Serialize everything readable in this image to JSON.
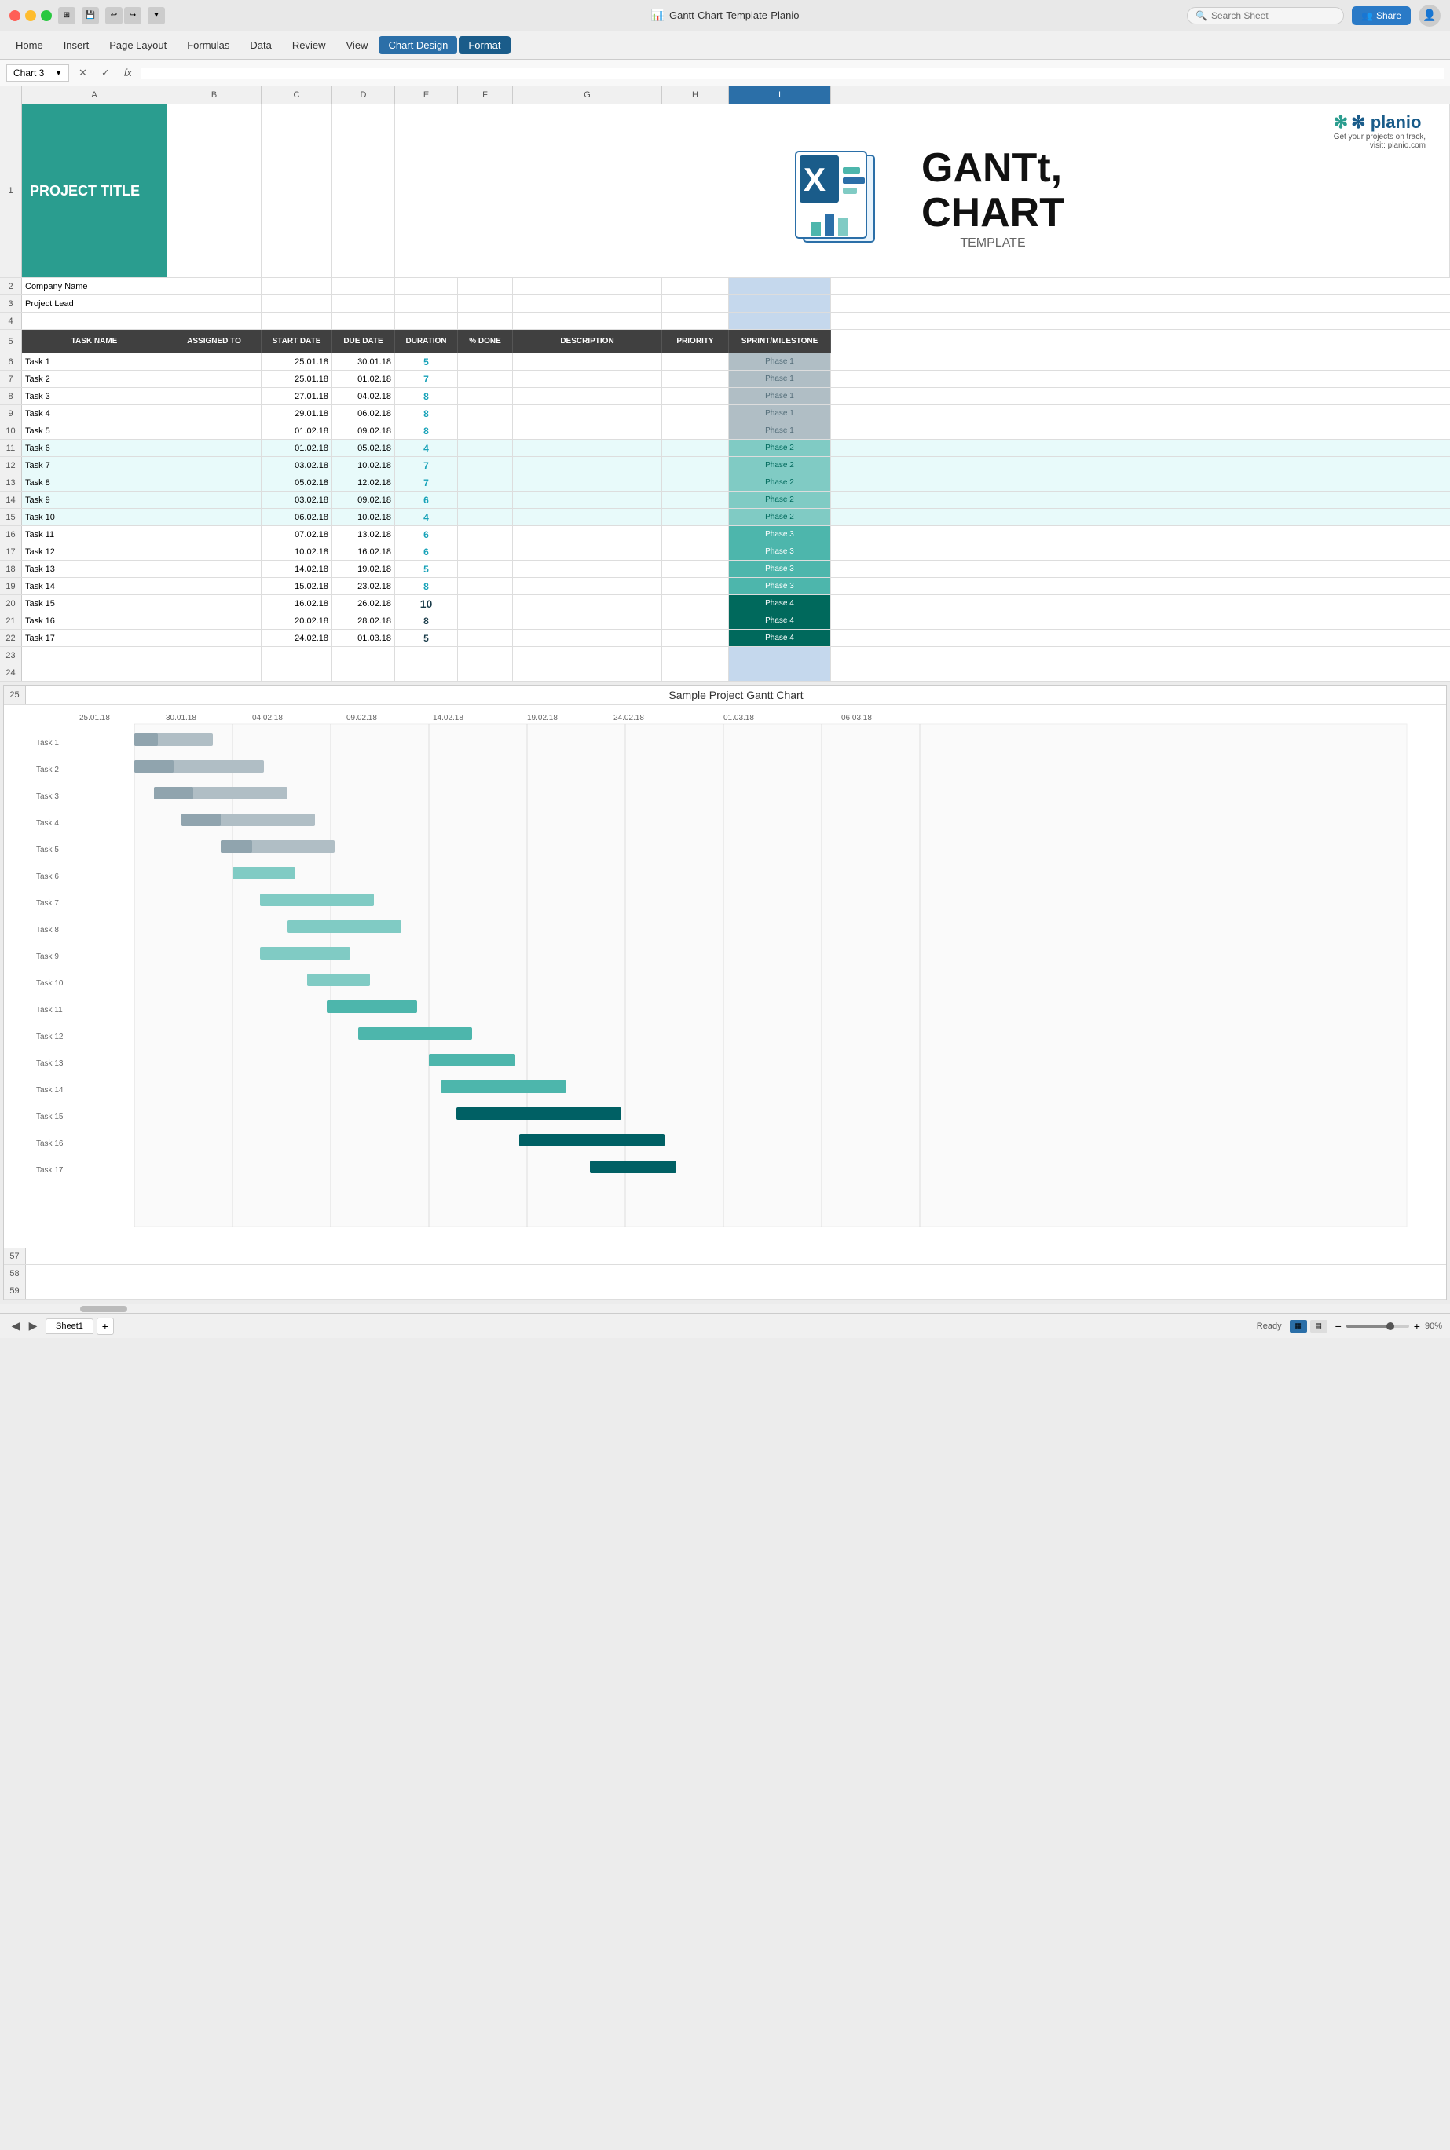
{
  "titlebar": {
    "traffic": [
      "red",
      "yellow",
      "green"
    ],
    "icons": [
      "grid",
      "save",
      "undo",
      "redo",
      "more"
    ],
    "filename": "Gantt-Chart-Template-Planio",
    "search_placeholder": "Search Sheet",
    "share_label": "Share",
    "avatar": "user"
  },
  "menubar": {
    "items": [
      {
        "label": "Home",
        "active": false
      },
      {
        "label": "Insert",
        "active": false
      },
      {
        "label": "Page Layout",
        "active": false
      },
      {
        "label": "Formulas",
        "active": false
      },
      {
        "label": "Data",
        "active": false
      },
      {
        "label": "Review",
        "active": false
      },
      {
        "label": "View",
        "active": false
      },
      {
        "label": "Chart Design",
        "active": true
      },
      {
        "label": "Format",
        "active": true
      }
    ]
  },
  "formulabar": {
    "cell_ref": "Chart 3",
    "x_label": "✕",
    "check_label": "✓",
    "fx_label": "fx",
    "formula": ""
  },
  "columns": {
    "headers": [
      "A",
      "B",
      "C",
      "D",
      "E",
      "F",
      "G",
      "H",
      "I"
    ],
    "widths": [
      185,
      120,
      90,
      80,
      80,
      70,
      190,
      85,
      130
    ]
  },
  "rows": {
    "row1": {
      "num": "1",
      "A": "PROJECT TITLE"
    },
    "row2": {
      "num": "2",
      "A": "Company Name"
    },
    "row3": {
      "num": "3",
      "A": "Project Lead"
    },
    "row4": {
      "num": "4"
    },
    "row5_header": {
      "num": "5",
      "A": "TASK NAME",
      "B": "ASSIGNED TO",
      "C": "START DATE",
      "D": "DUE DATE",
      "E": "DURATION",
      "F": "% DONE",
      "G": "DESCRIPTION",
      "H": "PRIORITY",
      "I": "SPRINT/MILESTONE"
    },
    "tasks": [
      {
        "num": "6",
        "name": "Task 1",
        "start": "25.01.18",
        "due": "30.01.18",
        "dur": "5",
        "done": "",
        "desc": "",
        "priority": "",
        "sprint": "Phase 1",
        "phase": 1
      },
      {
        "num": "7",
        "name": "Task 2",
        "start": "25.01.18",
        "due": "01.02.18",
        "dur": "7",
        "done": "",
        "desc": "",
        "priority": "",
        "sprint": "Phase 1",
        "phase": 1
      },
      {
        "num": "8",
        "name": "Task 3",
        "start": "27.01.18",
        "due": "04.02.18",
        "dur": "8",
        "done": "",
        "desc": "",
        "priority": "",
        "sprint": "Phase 1",
        "phase": 1
      },
      {
        "num": "9",
        "name": "Task 4",
        "start": "29.01.18",
        "due": "06.02.18",
        "dur": "8",
        "done": "",
        "desc": "",
        "priority": "",
        "sprint": "Phase 1",
        "phase": 1
      },
      {
        "num": "10",
        "name": "Task 5",
        "start": "01.02.18",
        "due": "09.02.18",
        "dur": "8",
        "done": "",
        "desc": "",
        "priority": "",
        "sprint": "Phase 1",
        "phase": 1
      },
      {
        "num": "11",
        "name": "Task 6",
        "start": "01.02.18",
        "due": "05.02.18",
        "dur": "4",
        "done": "",
        "desc": "",
        "priority": "",
        "sprint": "Phase 2",
        "phase": 2
      },
      {
        "num": "12",
        "name": "Task 7",
        "start": "03.02.18",
        "due": "10.02.18",
        "dur": "7",
        "done": "",
        "desc": "",
        "priority": "",
        "sprint": "Phase 2",
        "phase": 2
      },
      {
        "num": "13",
        "name": "Task 8",
        "start": "05.02.18",
        "due": "12.02.18",
        "dur": "7",
        "done": "",
        "desc": "",
        "priority": "",
        "sprint": "Phase 2",
        "phase": 2
      },
      {
        "num": "14",
        "name": "Task 9",
        "start": "03.02.18",
        "due": "09.02.18",
        "dur": "6",
        "done": "",
        "desc": "",
        "priority": "",
        "sprint": "Phase 2",
        "phase": 2
      },
      {
        "num": "15",
        "name": "Task 10",
        "start": "06.02.18",
        "due": "10.02.18",
        "dur": "4",
        "done": "",
        "desc": "",
        "priority": "",
        "sprint": "Phase 2",
        "phase": 2
      },
      {
        "num": "16",
        "name": "Task 11",
        "start": "07.02.18",
        "due": "13.02.18",
        "dur": "6",
        "done": "",
        "desc": "",
        "priority": "",
        "sprint": "Phase 3",
        "phase": 3
      },
      {
        "num": "17",
        "name": "Task 12",
        "start": "10.02.18",
        "due": "16.02.18",
        "dur": "6",
        "done": "",
        "desc": "",
        "priority": "",
        "sprint": "Phase 3",
        "phase": 3
      },
      {
        "num": "18",
        "name": "Task 13",
        "start": "14.02.18",
        "due": "19.02.18",
        "dur": "5",
        "done": "",
        "desc": "",
        "priority": "",
        "sprint": "Phase 3",
        "phase": 3
      },
      {
        "num": "19",
        "name": "Task 14",
        "start": "15.02.18",
        "due": "23.02.18",
        "dur": "8",
        "done": "",
        "desc": "",
        "priority": "",
        "sprint": "Phase 3",
        "phase": 3
      },
      {
        "num": "20",
        "name": "Task 15",
        "start": "16.02.18",
        "due": "26.02.18",
        "dur": "10",
        "done": "",
        "desc": "",
        "priority": "",
        "sprint": "Phase 4",
        "phase": 4
      },
      {
        "num": "21",
        "name": "Task 16",
        "start": "20.02.18",
        "due": "28.02.18",
        "dur": "8",
        "done": "",
        "desc": "",
        "priority": "",
        "sprint": "Phase 4",
        "phase": 4
      },
      {
        "num": "22",
        "name": "Task 17",
        "start": "24.02.18",
        "due": "01.03.18",
        "dur": "5",
        "done": "",
        "desc": "",
        "priority": "",
        "sprint": "Phase 4",
        "phase": 4
      }
    ],
    "empty_rows": [
      "23",
      "24"
    ]
  },
  "gantt_chart": {
    "title": "Sample Project Gantt Chart",
    "dates": [
      "25.01.18",
      "30.01.18",
      "04.02.18",
      "09.02.18",
      "14.02.18",
      "19.02.18",
      "24.02.18",
      "01.03.18",
      "06.03.18"
    ],
    "bars": [
      {
        "task": "Task 1",
        "start": 0,
        "width": 9,
        "phase": 1
      },
      {
        "task": "Task 2",
        "start": 0,
        "width": 13,
        "phase": 1
      },
      {
        "task": "Task 3",
        "start": 3,
        "width": 14,
        "phase": 1
      },
      {
        "task": "Task 4",
        "start": 6,
        "width": 14,
        "phase": 1
      },
      {
        "task": "Task 5",
        "start": 10,
        "width": 14,
        "phase": 1
      },
      {
        "task": "Task 6",
        "start": 10,
        "width": 7,
        "phase": 2
      },
      {
        "task": "Task 7",
        "start": 13,
        "width": 13,
        "phase": 2
      },
      {
        "task": "Task 8",
        "start": 16,
        "width": 13,
        "phase": 2
      },
      {
        "task": "Task 9",
        "start": 13,
        "width": 11,
        "phase": 2
      },
      {
        "task": "Task 10",
        "start": 18,
        "width": 7,
        "phase": 2
      },
      {
        "task": "Task 11",
        "start": 19,
        "width": 11,
        "phase": 3
      },
      {
        "task": "Task 12",
        "start": 22,
        "width": 11,
        "phase": 3
      },
      {
        "task": "Task 13",
        "start": 26,
        "width": 9,
        "phase": 3
      },
      {
        "task": "Task 14",
        "start": 27,
        "width": 15,
        "phase": 3
      },
      {
        "task": "Task 15",
        "start": 28,
        "width": 18,
        "phase": 4
      },
      {
        "task": "Task 16",
        "start": 33,
        "width": 15,
        "phase": 4
      },
      {
        "task": "Task 17",
        "start": 37,
        "width": 9,
        "phase": 4
      }
    ]
  },
  "bottombar": {
    "ready_label": "Ready",
    "sheet1_label": "Sheet1",
    "add_sheet_label": "+",
    "zoom": "90%",
    "nav_left": "◀",
    "nav_right": "▶"
  },
  "planio": {
    "logo_text": "✻ planio",
    "tagline": "Get your projects on track,",
    "tagline2": "visit: planio.com"
  }
}
